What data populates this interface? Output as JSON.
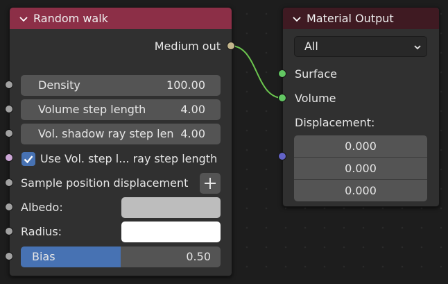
{
  "colors": {
    "random_walk_header": "#8c2f47",
    "material_output_header": "#3f1a22",
    "node_body": "#303030",
    "field": "#545454",
    "slider_fill": "#4772b3",
    "socket_float": "#a1a1a1",
    "socket_vector": "#6363c7",
    "socket_shader": "#63c763",
    "socket_medium": "#c4b68c",
    "socket_bool": "#cca6d6",
    "link": "#6cc74f",
    "albedo_swatch": "#bdbdbd",
    "radius_swatch": "#ffffff"
  },
  "random_walk": {
    "title": "Random walk",
    "collapse_icon": "chevron-down-icon",
    "output_label": "Medium out",
    "density": {
      "label": "Density",
      "value": "100.00"
    },
    "volume_step": {
      "label": "Volume step length",
      "value": "4.00"
    },
    "shadow_step": {
      "label": "Vol. shadow ray step len",
      "value": "4.00"
    },
    "use_step": {
      "label": "Use Vol. step l... ray step length",
      "checked": true
    },
    "sample_disp": {
      "label": "Sample position displacement",
      "button_icon": "plus-icon"
    },
    "albedo": {
      "label": "Albedo:"
    },
    "radius": {
      "label": "Radius:"
    },
    "bias": {
      "label": "Bias",
      "value": "0.50",
      "fraction": 0.5
    }
  },
  "material_output": {
    "title": "Material Output",
    "collapse_icon": "chevron-down-icon",
    "target": {
      "selected": "All",
      "icon": "chevron-down-icon"
    },
    "surface_label": "Surface",
    "volume_label": "Volume",
    "displacement_label": "Displacement:",
    "displacement_values": [
      "0.000",
      "0.000",
      "0.000"
    ]
  }
}
